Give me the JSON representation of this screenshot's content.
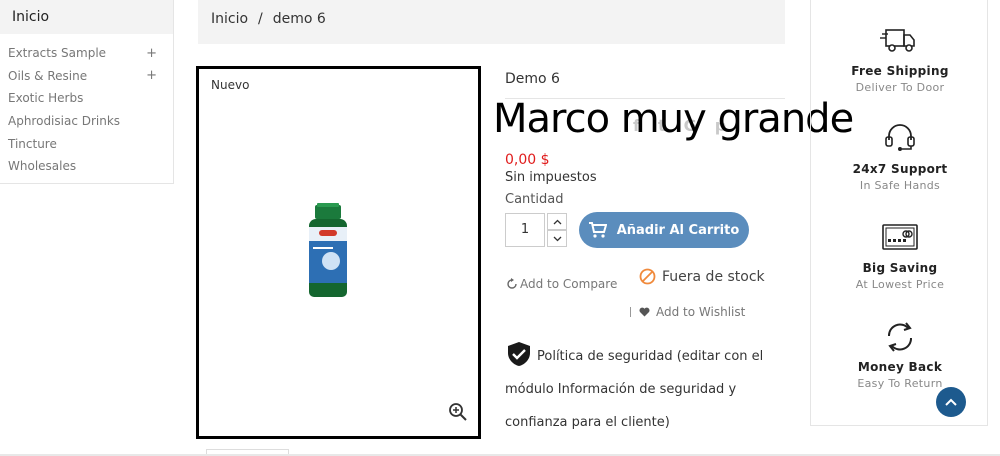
{
  "sidebar": {
    "title": "Inicio",
    "items": [
      {
        "label": "Extracts Sample",
        "expand": "+"
      },
      {
        "label": "Oils & Resine",
        "expand": "+"
      },
      {
        "label": "Exotic Herbs",
        "expand": ""
      },
      {
        "label": "Aphrodisiac Drinks",
        "expand": ""
      },
      {
        "label": "Tincture",
        "expand": ""
      },
      {
        "label": "Wholesales",
        "expand": ""
      }
    ]
  },
  "breadcrumb": {
    "home": "Inicio",
    "separator": "/",
    "current": "demo 6"
  },
  "product": {
    "badge": "Nuevo",
    "title": "Demo 6",
    "overlay_text": "Marco muy grande",
    "price": "0,00 $",
    "tax_note": "Sin impuestos",
    "quantity_label": "Cantidad",
    "quantity_value": "1",
    "add_to_cart_label": "Añadir Al Carrito",
    "compare_label": "Add to Compare",
    "stock_label": "Fuera de stock",
    "wishlist_label": "Add to Wishlist",
    "security_text": "Política de seguridad (editar con el módulo Información de seguridad y confianza para el cliente)"
  },
  "services": [
    {
      "icon": "delivery-truck-icon",
      "title": "Free Shipping",
      "subtitle": "Deliver To Door"
    },
    {
      "icon": "headset-icon",
      "title": "24x7 Support",
      "subtitle": "In Safe Hands"
    },
    {
      "icon": "cash-icon",
      "title": "Big Saving",
      "subtitle": "At Lowest Price"
    },
    {
      "icon": "refresh-icon",
      "title": "Money Back",
      "subtitle": "Easy To Return"
    }
  ],
  "colors": {
    "accent": "#5b8dbd",
    "price": "#e01c1c",
    "scroll_top": "#1d5a8e"
  }
}
